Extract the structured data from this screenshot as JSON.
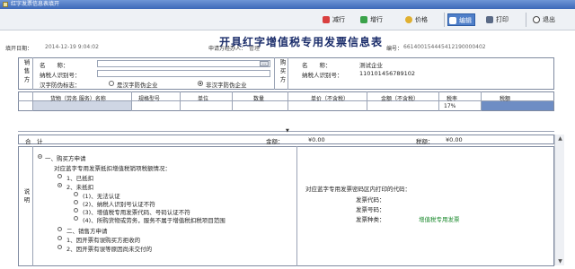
{
  "window": {
    "title": "红字发票信息表填开"
  },
  "toolbar": {
    "delete_row": "减行",
    "add_row": "增行",
    "price": "价格",
    "edit": "编辑",
    "print": "打印",
    "exit": "退出"
  },
  "form": {
    "title": "开具红字增值税专用发票信息表",
    "fill_date_label": "填开日期：",
    "fill_date": "2014-12-19 9:04:02",
    "applicant_label": "申请方经办人：",
    "applicant": "管理",
    "number_label": "编号：",
    "number": "661400154445412190000402"
  },
  "seller": {
    "side_label": "销售方",
    "name_label": "名　　称：",
    "name_value": "",
    "taxid_label": "纳税人识别号：",
    "taxid_value": "",
    "anticounterfeit_label": "汉字防伪标志：",
    "option_yes": "是汉字防伪企业",
    "option_no": "非汉字防伪企业",
    "selected": "非汉字防伪企业"
  },
  "buyer": {
    "side_label": "购买方",
    "name_label": "名　　称：",
    "name_value": "测试企业",
    "taxid_label": "纳税人识别号：",
    "taxid_value": "110101456789102"
  },
  "table": {
    "headers": [
      "货物（劳务 服务）名称",
      "规格型号",
      "单位",
      "数量",
      "单价（不含税）",
      "金额（不含税）",
      "税率",
      "税额"
    ],
    "rows": [
      {
        "name": "",
        "spec": "",
        "unit": "",
        "qty": "",
        "price": "",
        "amount": "",
        "rate": "17%",
        "tax": ""
      }
    ]
  },
  "totals": {
    "label": "合　计",
    "amount_label": "金额：",
    "amount": "¥0.00",
    "tax_label": "税额：",
    "tax": "¥0.00"
  },
  "notes": {
    "side_label": "说明",
    "section1": "一、购买方申请",
    "section1_question": "对应蓝字专用发票抵扣增值税销项税额情况：",
    "deducted": "1、已抵扣",
    "not_deducted": "2、未抵扣",
    "reasons": [
      "(1)、无法认证",
      "(2)、纳税人识别号认证不符",
      "(3)、增值税专用发票代码、号码认证不符",
      "(4)、所购货物或劳务，服务不属于增值税扣税项目范围"
    ],
    "section2": "二、销售方申请",
    "seller_reasons": [
      "1、因开票有误购买方拒收的",
      "2、因开票有误等原因尚未交付的"
    ],
    "right_title": "对应蓝字专用发票密码区内打印的代码：",
    "invoice_code_label": "发票代码：",
    "invoice_number_label": "发票号码：",
    "invoice_type_label": "发票种类：",
    "invoice_type": "增值税专用发票"
  }
}
